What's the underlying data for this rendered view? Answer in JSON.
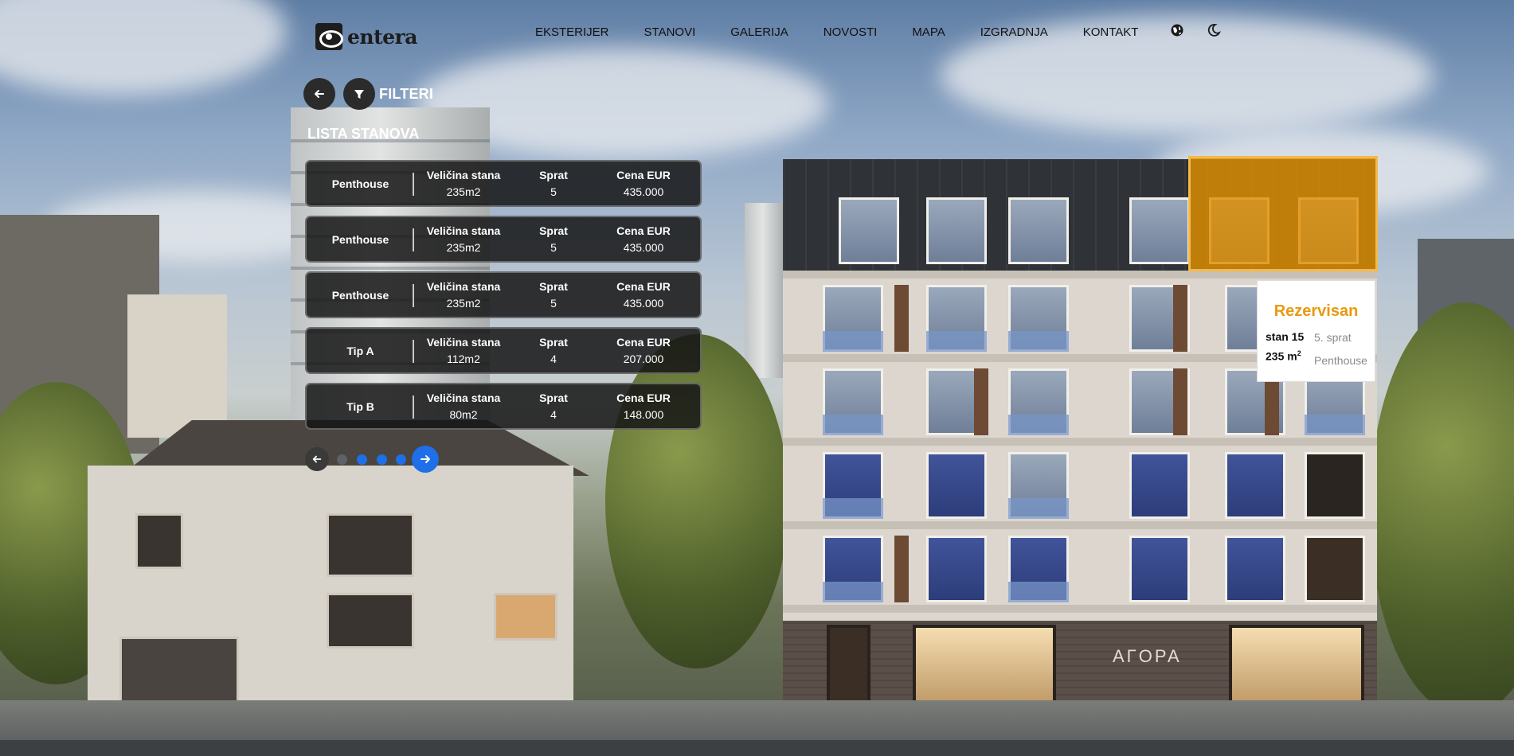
{
  "brand": {
    "name": "entera"
  },
  "nav": {
    "items": [
      "EKSTERIJER",
      "STANOVI",
      "GALERIJA",
      "NOVOSTI",
      "MAPA",
      "IZGRADNJA",
      "KONTAKT"
    ],
    "icons": [
      "globe-icon",
      "moon-icon"
    ]
  },
  "panel": {
    "filter_label": "FILTERI",
    "list_title": "LISTA STANOVA",
    "rows": [
      {
        "type": "Penthouse",
        "size_label": "Veličina stana",
        "size": "235m2",
        "floor_label": "Sprat",
        "floor": "5",
        "price_label": "Cena EUR",
        "price": "435.000"
      },
      {
        "type": "Penthouse",
        "size_label": "Veličina stana",
        "size": "235m2",
        "floor_label": "Sprat",
        "floor": "5",
        "price_label": "Cena EUR",
        "price": "435.000"
      },
      {
        "type": "Penthouse",
        "size_label": "Veličina stana",
        "size": "235m2",
        "floor_label": "Sprat",
        "floor": "5",
        "price_label": "Cena EUR",
        "price": "435.000"
      },
      {
        "type": "Tip A",
        "size_label": "Veličina stana",
        "size": "112m2",
        "floor_label": "Sprat",
        "floor": "4",
        "price_label": "Cena EUR",
        "price": "207.000"
      },
      {
        "type": "Tip B",
        "size_label": "Veličina stana",
        "size": "80m2",
        "floor_label": "Sprat",
        "floor": "4",
        "price_label": "Cena EUR",
        "price": "148.000"
      }
    ],
    "pagination": {
      "pages": 4,
      "current": 4
    }
  },
  "unit_card": {
    "status": "Rezervisan",
    "unit": "stan 15",
    "size": "235 m",
    "size_sup": "2",
    "floor": "5. sprat",
    "type": "Penthouse"
  },
  "building_sign": "AΓOPA",
  "colors": {
    "accent_blue": "#1e6fe8",
    "reserved_orange": "#e89a10",
    "highlight_fill": "#df8d00"
  }
}
